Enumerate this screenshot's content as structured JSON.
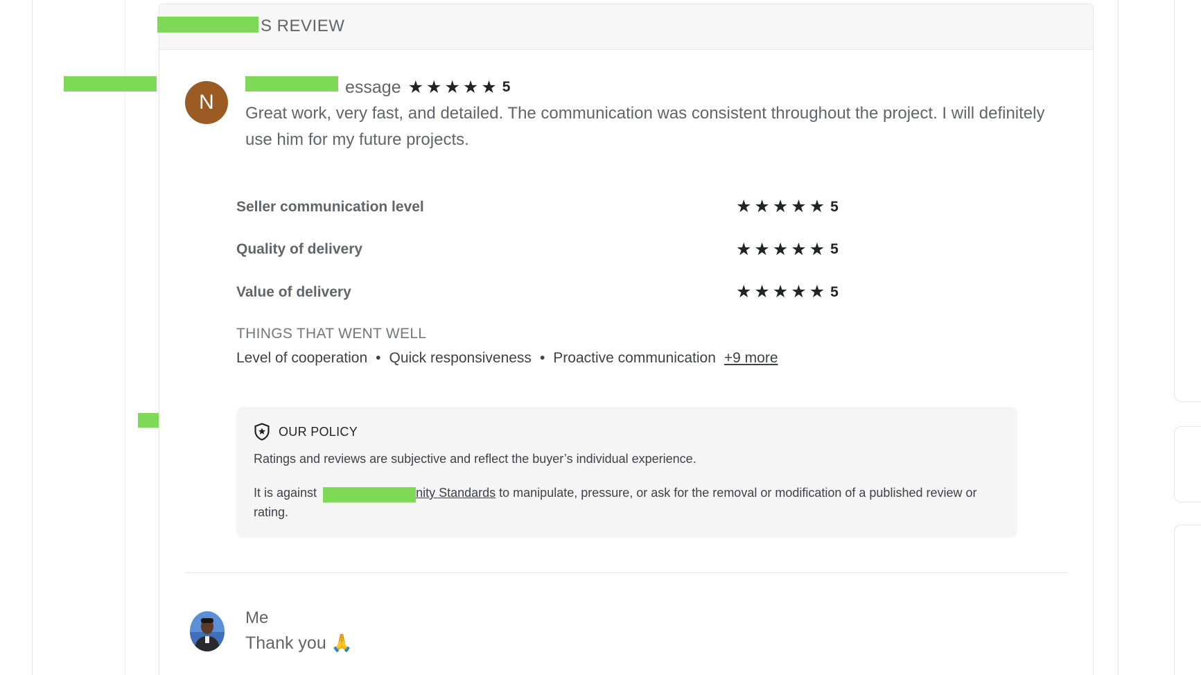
{
  "card": {
    "title": "S REVIEW"
  },
  "review": {
    "avatar_letter": "N",
    "avatar_color": "#9b5a21",
    "reviewer_name_suffix": "essage",
    "overall_rating": 5,
    "overall_rating_label": "5",
    "text": "Great work, very fast, and detailed. The communication was consistent throughout the project. I will definitely use him for my future projects."
  },
  "ratings": [
    {
      "label": "Seller communication level",
      "value": 5,
      "value_label": "5"
    },
    {
      "label": "Quality of delivery",
      "value": 5,
      "value_label": "5"
    },
    {
      "label": "Value of delivery",
      "value": 5,
      "value_label": "5"
    }
  ],
  "went_well": {
    "title": "THINGS THAT WENT WELL",
    "items": [
      "Level of cooperation",
      "Quick responsiveness",
      "Proactive communication"
    ],
    "separator": "•",
    "more_label": "+9 more"
  },
  "policy": {
    "title": "OUR POLICY",
    "icon": "shield-star-icon",
    "line1": "Ratings and reviews are subjective and reflect the buyer’s individual experience.",
    "line2_prefix": "It is against",
    "line2_link": "nity Standards",
    "line2_suffix": "to manipulate, pressure, or ask for the removal or modification of a published review or rating."
  },
  "reply": {
    "name": "Me",
    "text": "Thank you 🙏"
  },
  "colors": {
    "redaction": "#7ed957",
    "star": "#222325",
    "policy_bg": "#f5f5f5"
  }
}
